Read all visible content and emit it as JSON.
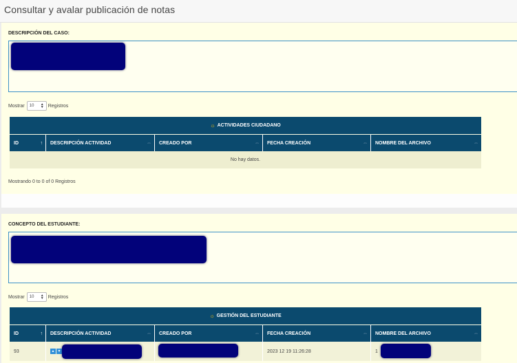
{
  "header": {
    "title": "Consultar y avalar publicación de notas"
  },
  "section1": {
    "label": "DESCRIPCIÓN DEL CASO:",
    "length": {
      "prefix": "Mostrar",
      "value": "10",
      "suffix": "Registros"
    },
    "table": {
      "caption": "ACTIVIDADES CIUDADANO",
      "columns": [
        "ID",
        "DESCRIPCIÓN ACTIVIDAD",
        "CREADO POR",
        "FECHA CREACIÓN",
        "NOMBRE DEL ARCHIVO"
      ],
      "empty_text": "No hay datos."
    },
    "info": "Mostrando 0 to 0 of 0 Registros"
  },
  "section2": {
    "label": "CONCEPTO DEL ESTUDIANTE:",
    "length": {
      "prefix": "Mostrar",
      "value": "10",
      "suffix": "Registros"
    },
    "table": {
      "caption": "GESTIÓN DEL ESTUDIANTE",
      "columns": [
        "ID",
        "DESCRIPCIÓN ACTIVIDAD",
        "CREADO POR",
        "FECHA CREACIÓN",
        "NOMBRE DEL ARCHIVO"
      ],
      "rows": [
        {
          "id": "93",
          "fecha": "2023 12 19 11:26:28",
          "archivo_prefix": "1"
        }
      ]
    }
  },
  "icons": {
    "caption_icon": "sun-icon",
    "sort_icon": "sort-arrows-icon",
    "select_icon": "updown-icon",
    "row_actions": [
      "arrow-up-icon",
      "arrow-down-icon"
    ]
  },
  "colors": {
    "header_bg": "#0b4a6e",
    "panel_bg": "#ffffe6",
    "redaction": "#02027a",
    "textbox_border": "#3c90c6"
  }
}
